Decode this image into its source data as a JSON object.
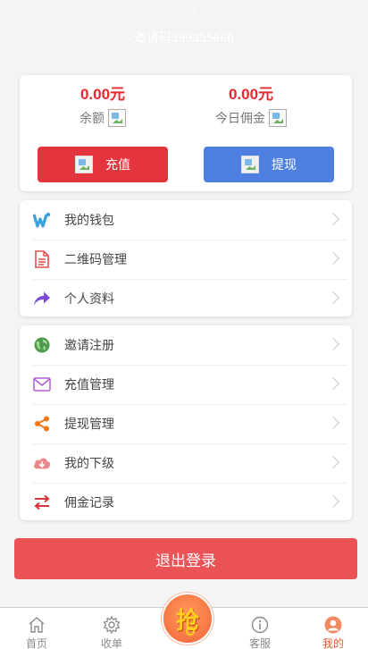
{
  "header": {
    "username": "hhg",
    "invite_code": "邀请码399335660"
  },
  "balance": {
    "balance_amount": "0.00元",
    "balance_label": "余额",
    "commission_amount": "0.00元",
    "commission_label": "今日佣金",
    "recharge_label": "充值",
    "withdraw_label": "提现"
  },
  "menu_group_1": [
    {
      "label": "我的钱包",
      "icon": "wallet-icon"
    },
    {
      "label": "二维码管理",
      "icon": "document-icon"
    },
    {
      "label": "个人资料",
      "icon": "share-arrow-icon"
    }
  ],
  "menu_group_2": [
    {
      "label": "邀请注册",
      "icon": "globe-icon"
    },
    {
      "label": "充值管理",
      "icon": "mail-icon"
    },
    {
      "label": "提现管理",
      "icon": "share-nodes-icon"
    },
    {
      "label": "我的下级",
      "icon": "cloud-download-icon"
    },
    {
      "label": "佣金记录",
      "icon": "swap-arrows-icon"
    }
  ],
  "logout_label": "退出登录",
  "tabbar": {
    "home": "首页",
    "collect": "收单",
    "grab": "抢",
    "service": "客服",
    "mine": "我的"
  },
  "colors": {
    "amount_red": "#e5282f",
    "recharge_button": "#e4353f",
    "withdraw_button": "#4c7fdf",
    "logout_button": "#eb5356",
    "active_tab": "#e25a2d"
  }
}
